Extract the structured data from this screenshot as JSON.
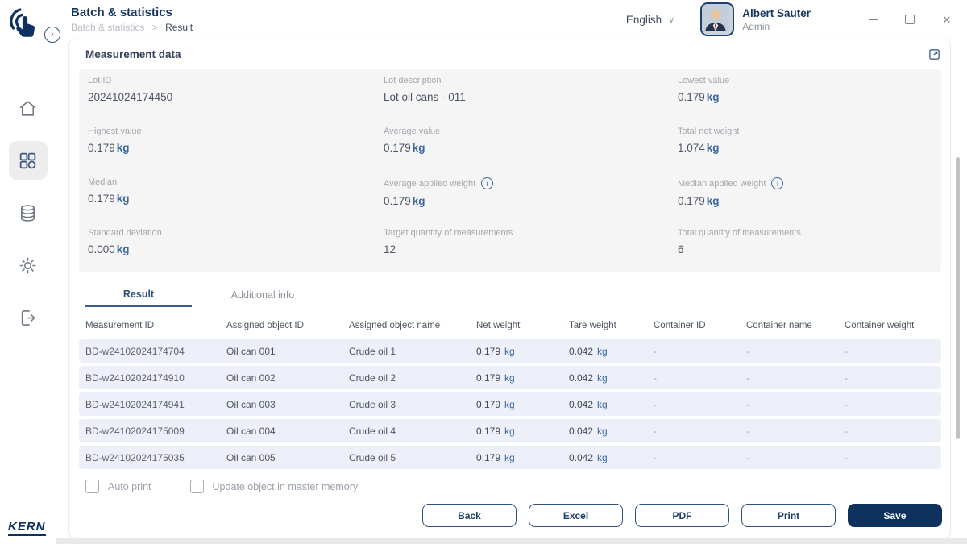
{
  "app": {
    "brand": "KERN"
  },
  "sidebar": {
    "collapse_chevron": "›",
    "icons": [
      "home-icon",
      "apps-grid-icon",
      "database-icon",
      "settings-gear-icon",
      "logout-icon"
    ]
  },
  "header": {
    "title": "Batch & statistics",
    "breadcrumb": {
      "parent": "Batch & statistics",
      "separator": ">",
      "current": "Result"
    },
    "language": {
      "label": "English",
      "chevron": "∨"
    },
    "user": {
      "name": "Albert Sauter",
      "role": "Admin"
    },
    "window_controls": {
      "close": "✕"
    }
  },
  "panel": {
    "title": "Measurement data"
  },
  "stats": [
    {
      "label": "Lot ID",
      "value": "20241024174450",
      "unit": ""
    },
    {
      "label": "Lot description",
      "value": "Lot oil cans - 011",
      "unit": ""
    },
    {
      "label": "Lowest value",
      "value": "0.179",
      "unit": "kg"
    },
    {
      "label": "Highest value",
      "value": "0.179",
      "unit": "kg"
    },
    {
      "label": "Average value",
      "value": "0.179",
      "unit": "kg"
    },
    {
      "label": "Total net weight",
      "value": "1.074",
      "unit": "kg"
    },
    {
      "label": "Median",
      "value": "0.179",
      "unit": "kg"
    },
    {
      "label": "Average applied weight",
      "value": "0.179",
      "unit": "kg",
      "info": true
    },
    {
      "label": "Median applied weight",
      "value": "0.179",
      "unit": "kg",
      "info": true
    },
    {
      "label": "Standard deviation",
      "value": "0.000",
      "unit": "kg"
    },
    {
      "label": "Target quantity of measurements",
      "value": "12",
      "unit": ""
    },
    {
      "label": "Total quantity of measurements",
      "value": "6",
      "unit": ""
    }
  ],
  "tabs": [
    {
      "label": "Result",
      "active": true
    },
    {
      "label": "Additional info",
      "active": false
    }
  ],
  "table": {
    "columns": [
      "Measurement ID",
      "Assigned object ID",
      "Assigned object name",
      "Net weight",
      "Tare weight",
      "Container ID",
      "Container name",
      "Container weight"
    ],
    "rows": [
      {
        "measurement_id": "BD-w24102024174704",
        "object_id": "Oil can 001",
        "object_name": "Crude oil 1",
        "net_weight": "0.179",
        "net_unit": "kg",
        "tare_weight": "0.042",
        "tare_unit": "kg",
        "container_id": "-",
        "container_name": "-",
        "container_weight": "-"
      },
      {
        "measurement_id": "BD-w24102024174910",
        "object_id": "Oil can 002",
        "object_name": "Crude oil 2",
        "net_weight": "0.179",
        "net_unit": "kg",
        "tare_weight": "0.042",
        "tare_unit": "kg",
        "container_id": "-",
        "container_name": "-",
        "container_weight": "-"
      },
      {
        "measurement_id": "BD-w24102024174941",
        "object_id": "Oil can 003",
        "object_name": "Crude oil 3",
        "net_weight": "0.179",
        "net_unit": "kg",
        "tare_weight": "0.042",
        "tare_unit": "kg",
        "container_id": "-",
        "container_name": "-",
        "container_weight": "-"
      },
      {
        "measurement_id": "BD-w24102024175009",
        "object_id": "Oil can 004",
        "object_name": "Crude oil 4",
        "net_weight": "0.179",
        "net_unit": "kg",
        "tare_weight": "0.042",
        "tare_unit": "kg",
        "container_id": "-",
        "container_name": "-",
        "container_weight": "-"
      },
      {
        "measurement_id": "BD-w24102024175035",
        "object_id": "Oil can 005",
        "object_name": "Crude oil 5",
        "net_weight": "0.179",
        "net_unit": "kg",
        "tare_weight": "0.042",
        "tare_unit": "kg",
        "container_id": "-",
        "container_name": "-",
        "container_weight": "-"
      }
    ]
  },
  "footer": {
    "checkboxes": [
      {
        "label": "Auto print",
        "checked": false
      },
      {
        "label": "Update object in master memory",
        "checked": false
      }
    ],
    "buttons": [
      {
        "label": "Back",
        "variant": "outline"
      },
      {
        "label": "Excel",
        "variant": "outline"
      },
      {
        "label": "PDF",
        "variant": "outline"
      },
      {
        "label": "Print",
        "variant": "outline"
      },
      {
        "label": "Save",
        "variant": "primary"
      }
    ]
  },
  "colors": {
    "navy": "#0e315e",
    "accent_blue": "#3a689e",
    "row_bg": "#edf0f8",
    "label_gray": "#a3a7ad"
  }
}
